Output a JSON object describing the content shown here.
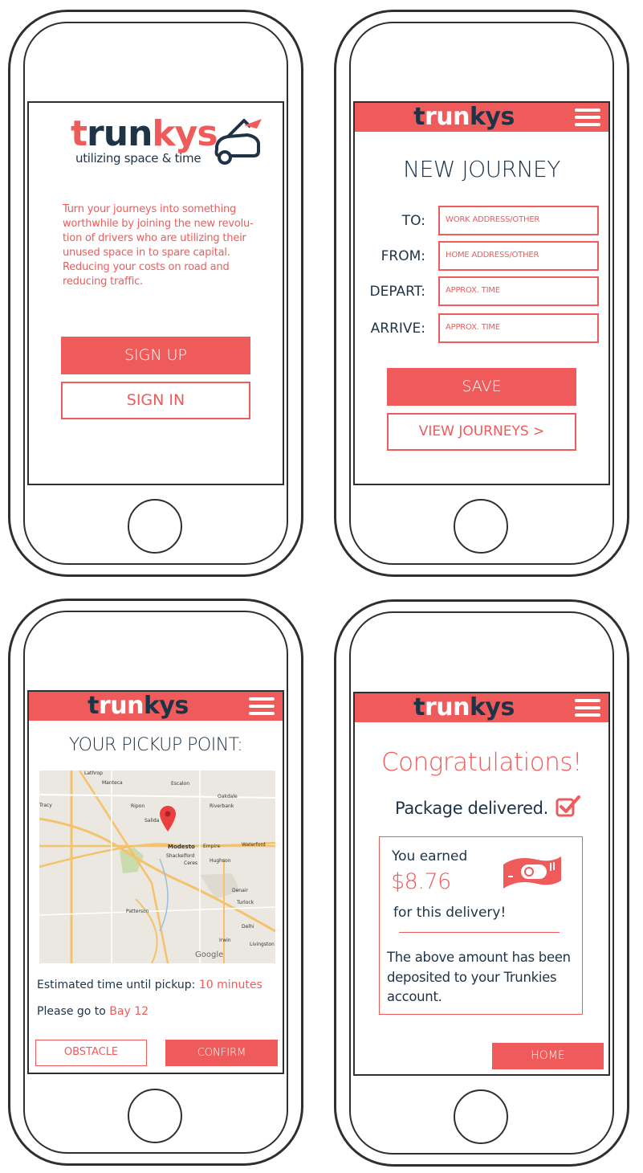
{
  "brand": {
    "logo_prefix": "t",
    "logo_main": "run",
    "logo_suffix": "kys",
    "tagline": "utilizing space & time",
    "accent_color": "#ef5b5b",
    "dark_color": "#1f3347"
  },
  "screen1": {
    "intro": "Turn your journeys into something worthwhile by joining the new revolu- tion of drivers who are utilizing their unused space in to spare capital. Reducing your costs on road and reducing traffic.",
    "signup_label": "SIGN UP",
    "signin_label": "SIGN IN"
  },
  "screen2": {
    "title": "NEW JOURNEY",
    "fields": [
      {
        "label": "TO:",
        "placeholder": "WORK ADDRESS/OTHER"
      },
      {
        "label": "FROM:",
        "placeholder": "HOME ADDRESS/OTHER"
      },
      {
        "label": "DEPART:",
        "placeholder": "APPROX. TIME"
      },
      {
        "label": "ARRIVE:",
        "placeholder": "APPROX. TIME"
      }
    ],
    "save_label": "SAVE",
    "view_label": "VIEW JOURNEYS >"
  },
  "screen3": {
    "title": "YOUR PICKUP POINT:",
    "map_labels": {
      "lathrop": "Lathrop",
      "manteca": "Manteca",
      "escalon": "Escalon",
      "oakdale": "Oakdale",
      "tracy": "Tracy",
      "ripon": "Ripon",
      "riverbank": "Riverbank",
      "salida": "Salida",
      "modesto": "Modesto",
      "empire": "Empire",
      "waterford": "Waterford",
      "shackelford": "Shackelford",
      "ceres": "Ceres",
      "hughson": "Hughson",
      "denair": "Denair",
      "patterson": "Patterson",
      "turlock": "Turlock",
      "delhi": "Delhi",
      "livingston": "Livingston",
      "irwin": "Irwin",
      "google": "Google"
    },
    "eta_label": "Estimated time until pickup:",
    "eta_value": "10 minutes",
    "go_label": "Please go to",
    "go_value": "Bay 12",
    "obstacle_label": "OBSTACLE",
    "confirm_label": "CONFIRM"
  },
  "screen4": {
    "congrats": "Congratulations!",
    "delivered": "Package delivered.",
    "earned_label": "You earned",
    "amount": "$8.76",
    "for_label": "for this delivery!",
    "deposit_text": "The above amount has been deposited to your Trunkies account.",
    "home_label": "HOME"
  }
}
